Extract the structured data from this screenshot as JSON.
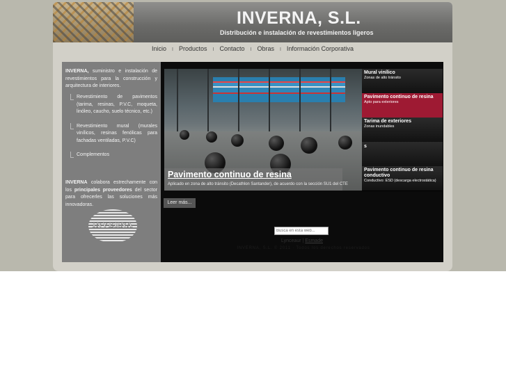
{
  "header": {
    "brand": "INVERNA, S.L.",
    "tagline": "Distribución e instalación de revestimientos ligeros"
  },
  "nav": {
    "items": [
      {
        "label": "Inicio"
      },
      {
        "label": "Productos"
      },
      {
        "label": "Contacto"
      },
      {
        "label": "Obras"
      },
      {
        "label": "Información Corporativa"
      }
    ],
    "separator": "I"
  },
  "sidebar": {
    "intro_bold": "INVERNA,",
    "intro_text": " suministro e instalación de revestimientos para la construcción y arquitectura de interiores.",
    "list": [
      "Revestimiento de pavimentos (tarima, resinas, P.V.C, moqueta, linóleo, caucho, suelo técnico, etc.)",
      "Revestimiento mural (murales vinílicos, resinas fenólicas para fachadas ventiladas, P.V.C)",
      "Complementos"
    ],
    "collab_bold": "INVERNA",
    "collab_text_1": " colabora estrechamente con los ",
    "collab_bold_2": "principales proveedores",
    "collab_text_2": " del sector para ofrecerles las soluciones más innovadoras.",
    "logo_text": "INVERNA"
  },
  "slideshow": {
    "caption_title": "Pavimento continuo de resina",
    "caption_text": "Aplicado en zona de alto tránsito (Decathlon Santander), de acuerdo con la sección SU1 del CTE",
    "read_more": "Leer más...",
    "tabs": [
      {
        "title": "Mural vinílico",
        "subtitle": "Zonas de alto tránsito",
        "active": false
      },
      {
        "title": "Pavimento continuo de resina",
        "subtitle": "Apto para exteriores",
        "active": true
      },
      {
        "title": "Tarima de exteriores",
        "subtitle": "Zonas inundables",
        "active": false
      },
      {
        "title": "s",
        "subtitle": "",
        "active": false
      },
      {
        "title": "Pavimento continuo de resina conductivo",
        "subtitle": "Conductivo: ESD (descarga electrostática)",
        "active": false
      }
    ]
  },
  "footer": {
    "search_placeholder": "Busca en esta web...",
    "link_lynceaur": "Lynceaur",
    "link_sep": "|",
    "link_esmade": "Esmade",
    "copyright": "INVERNA, S.L. © 2011 · Todos los derechos reservados"
  },
  "colors": {
    "active_tab": "#9e1a33",
    "header": "#6a6a68",
    "page_band": "#b9b8ad"
  }
}
